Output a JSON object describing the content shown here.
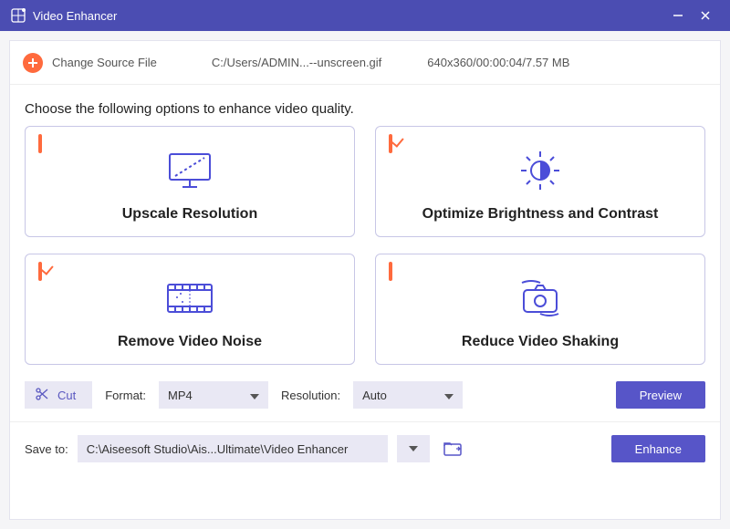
{
  "titlebar": {
    "title": "Video Enhancer"
  },
  "source": {
    "change_label": "Change Source File",
    "path": "C:/Users/ADMIN...--unscreen.gif",
    "meta": "640x360/00:00:04/7.57 MB"
  },
  "choose_label": "Choose the following options to enhance video quality.",
  "cards": [
    {
      "label": "Upscale Resolution",
      "checked": false
    },
    {
      "label": "Optimize Brightness and Contrast",
      "checked": true
    },
    {
      "label": "Remove Video Noise",
      "checked": true
    },
    {
      "label": "Reduce Video Shaking",
      "checked": false
    }
  ],
  "controls": {
    "cut_label": "Cut",
    "format_label": "Format:",
    "format_value": "MP4",
    "resolution_label": "Resolution:",
    "resolution_value": "Auto",
    "preview_label": "Preview"
  },
  "save": {
    "label": "Save to:",
    "path": "C:\\Aiseesoft Studio\\Ais...Ultimate\\Video Enhancer",
    "enhance_label": "Enhance"
  }
}
